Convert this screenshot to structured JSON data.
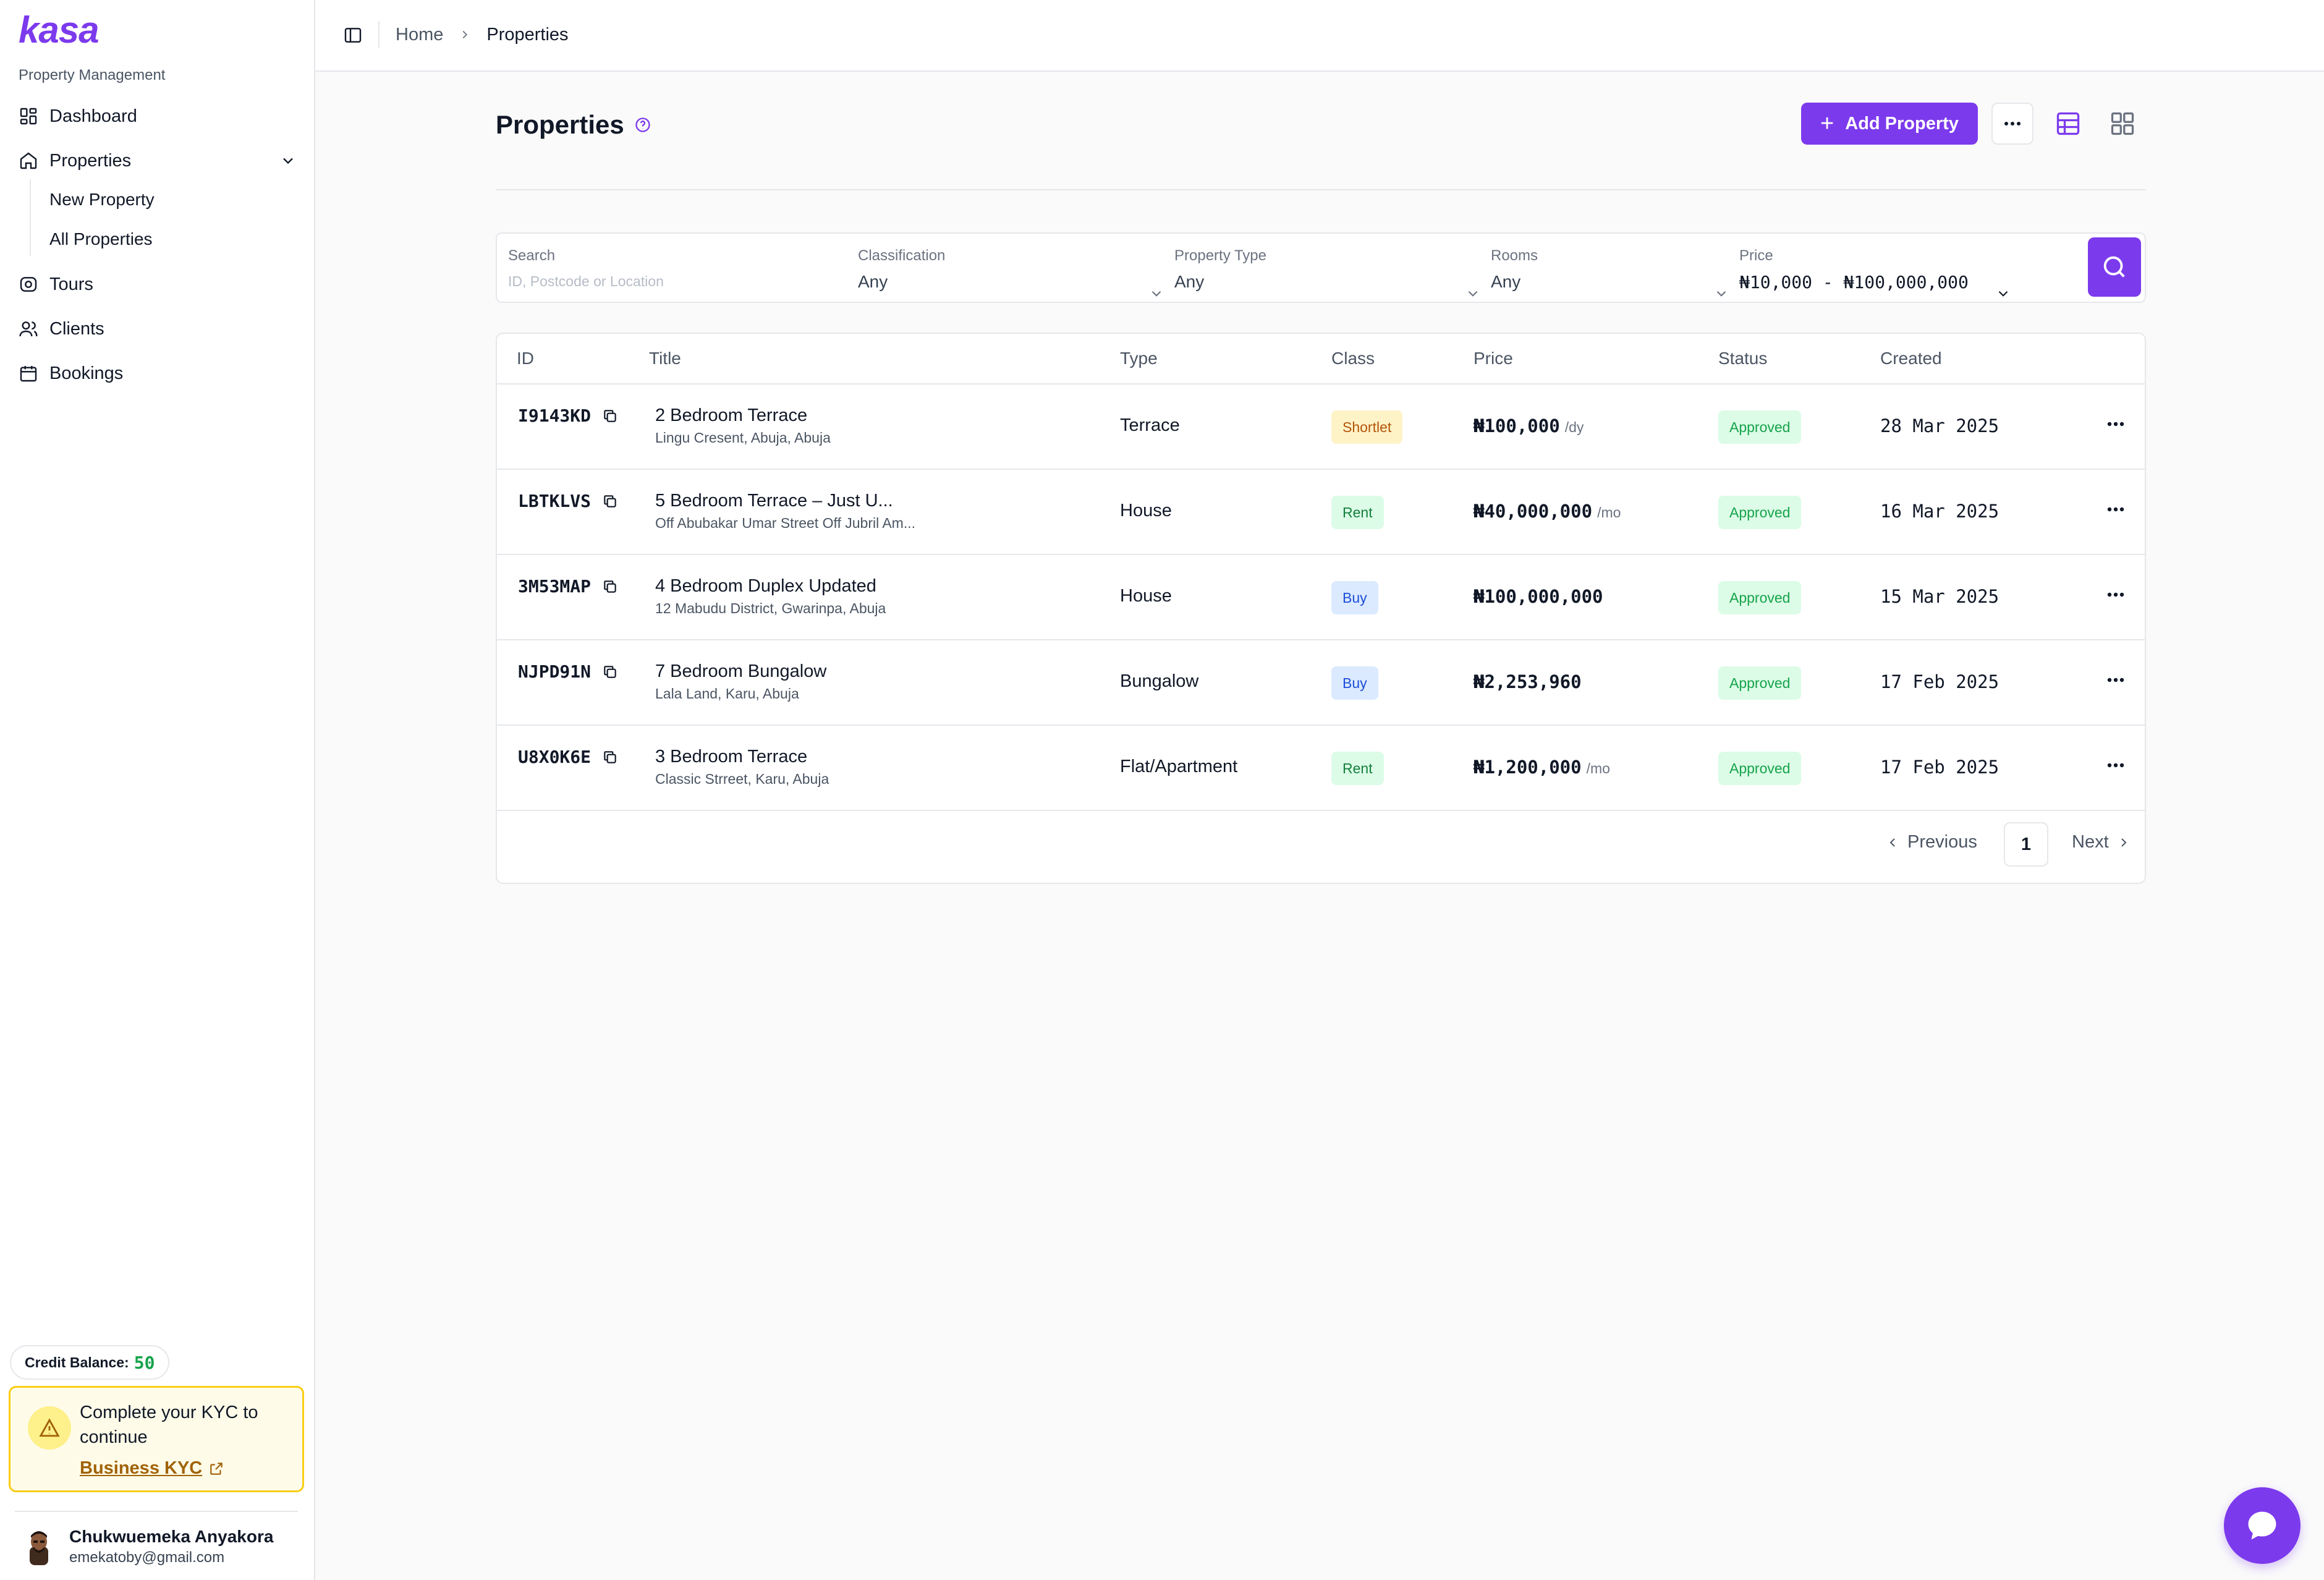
{
  "app": {
    "logo": "kasa",
    "section_label": "Property Management"
  },
  "sidebar": {
    "items": [
      {
        "label": "Dashboard",
        "icon": "dashboard-icon"
      },
      {
        "label": "Properties",
        "icon": "home-icon"
      },
      {
        "label": "Tours",
        "icon": "tour-icon"
      },
      {
        "label": "Clients",
        "icon": "users-icon"
      },
      {
        "label": "Bookings",
        "icon": "calendar-icon"
      }
    ],
    "sub_items": [
      "New Property",
      "All Properties"
    ],
    "credit": {
      "label": "Credit Balance:",
      "value": "50"
    },
    "kyc": {
      "message": "Complete your KYC to continue",
      "link": "Business KYC"
    },
    "user": {
      "name": "Chukwuemeka Anyakora",
      "email": "emekatoby@gmail.com"
    }
  },
  "breadcrumb": {
    "home": "Home",
    "current": "Properties"
  },
  "header": {
    "title": "Properties",
    "add_label": "Add Property"
  },
  "filters": {
    "search": {
      "label": "Search",
      "placeholder": "ID, Postcode or Location"
    },
    "classification": {
      "label": "Classification",
      "value": "Any"
    },
    "property_type": {
      "label": "Property Type",
      "value": "Any"
    },
    "rooms": {
      "label": "Rooms",
      "value": "Any"
    },
    "price": {
      "label": "Price",
      "value": "₦10,000 - ₦100,000,000"
    }
  },
  "table": {
    "columns": [
      "ID",
      "Title",
      "Type",
      "Class",
      "Price",
      "Status",
      "Created"
    ],
    "rows": [
      {
        "id": "I9143KD",
        "title": "2 Bedroom Terrace",
        "address": "Lingu Cresent, Abuja, Abuja",
        "type": "Terrace",
        "class": "Shortlet",
        "price": "₦100,000",
        "unit": "/dy",
        "status": "Approved",
        "created": "28 Mar 2025"
      },
      {
        "id": "LBTKLVS",
        "title": "5 Bedroom Terrace – Just U...",
        "address": "Off Abubakar Umar Street Off Jubril Am...",
        "type": "House",
        "class": "Rent",
        "price": "₦40,000,000",
        "unit": "/mo",
        "status": "Approved",
        "created": "16 Mar 2025"
      },
      {
        "id": "3M53MAP",
        "title": "4 Bedroom Duplex Updated",
        "address": "12 Mabudu District, Gwarinpa, Abuja",
        "type": "House",
        "class": "Buy",
        "price": "₦100,000,000",
        "unit": "",
        "status": "Approved",
        "created": "15 Mar 2025"
      },
      {
        "id": "NJPD91N",
        "title": "7 Bedroom Bungalow",
        "address": "Lala Land, Karu, Abuja",
        "type": "Bungalow",
        "class": "Buy",
        "price": "₦2,253,960",
        "unit": "",
        "status": "Approved",
        "created": "17 Feb 2025"
      },
      {
        "id": "U8X0K6E",
        "title": "3 Bedroom Terrace",
        "address": "Classic Strreet, Karu, Abuja",
        "type": "Flat/Apartment",
        "class": "Rent",
        "price": "₦1,200,000",
        "unit": "/mo",
        "status": "Approved",
        "created": "17 Feb 2025"
      }
    ]
  },
  "pagination": {
    "previous": "Previous",
    "page": "1",
    "next": "Next"
  },
  "colors": {
    "accent": "#7c3aed",
    "shortlet_bg": "#fef3c7",
    "shortlet_fg": "#b45309",
    "rent_bg": "#dcfce7",
    "rent_fg": "#15803d",
    "buy_bg": "#dbeafe",
    "buy_fg": "#1d4ed8",
    "approved": "#16a34a"
  }
}
